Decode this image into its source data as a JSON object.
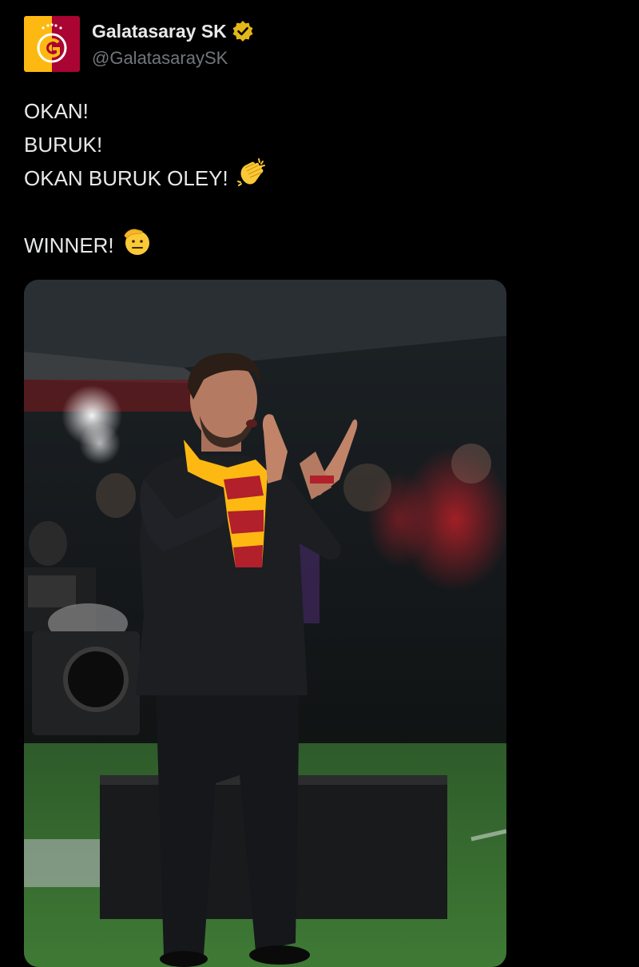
{
  "tweet": {
    "display_name": "Galatasaray SK",
    "handle": "@GalatasaraySK",
    "lines": [
      "OKAN!",
      "BURUK!",
      "OKAN BURUK OLEY!",
      "",
      "WINNER!"
    ],
    "emojis": {
      "line3": "clapping-hands-emoji",
      "line5": "saluting-face-emoji"
    }
  },
  "colors": {
    "background": "#000000",
    "text_primary": "#e7e9ea",
    "text_secondary": "#71767b",
    "verified_gold": "#e2b719",
    "brand_red": "#a90432",
    "brand_yellow": "#fdb912"
  },
  "media": {
    "alt": "Galatasaray coach clapping on the sideline wearing a red and yellow scarf"
  }
}
